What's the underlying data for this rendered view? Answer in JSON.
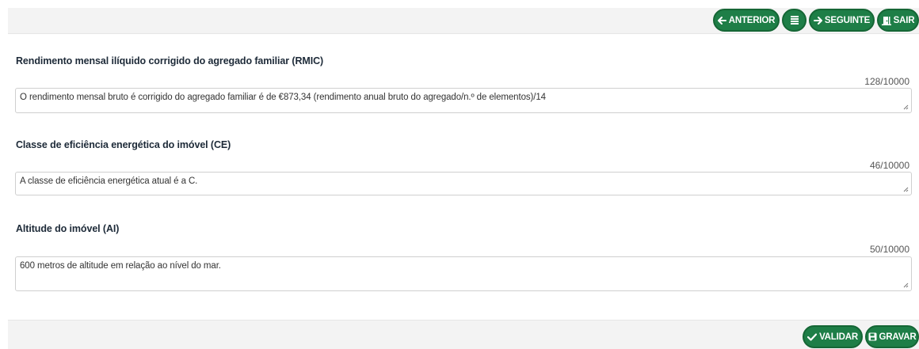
{
  "toolbar": {
    "anterior_label": "ANTERIOR",
    "seguinte_label": "SEGUINTE",
    "sair_label": "SAIR"
  },
  "fields": [
    {
      "label": "Rendimento mensal ilíquido corrigido do agregado familiar (RMIC)",
      "counter": "128/10000",
      "value": "O rendimento mensal bruto é corrigido do agregado familiar é de €873,34 (rendimento anual bruto do agregado/n.º de elementos)/14"
    },
    {
      "label": "Classe de eficiência energética do imóvel (CE)",
      "counter": "46/10000",
      "value": "A classe de eficiência energética atual é a C."
    },
    {
      "label": "Altitude do imóvel (AI)",
      "counter": "50/10000",
      "value": "600 metros de altitude em relação ao nível do mar."
    }
  ],
  "footer": {
    "validar_label": "VALIDAR",
    "gravar_label": "GRAVAR"
  },
  "colors": {
    "button_green": "#1e7e47",
    "bar_background": "#f3f3f3"
  },
  "icons": {
    "anterior": "arrow-left-icon",
    "menu": "list-icon",
    "seguinte": "arrow-right-icon",
    "sair": "door-exit-icon",
    "validar": "check-icon",
    "gravar": "floppy-disk-icon"
  }
}
